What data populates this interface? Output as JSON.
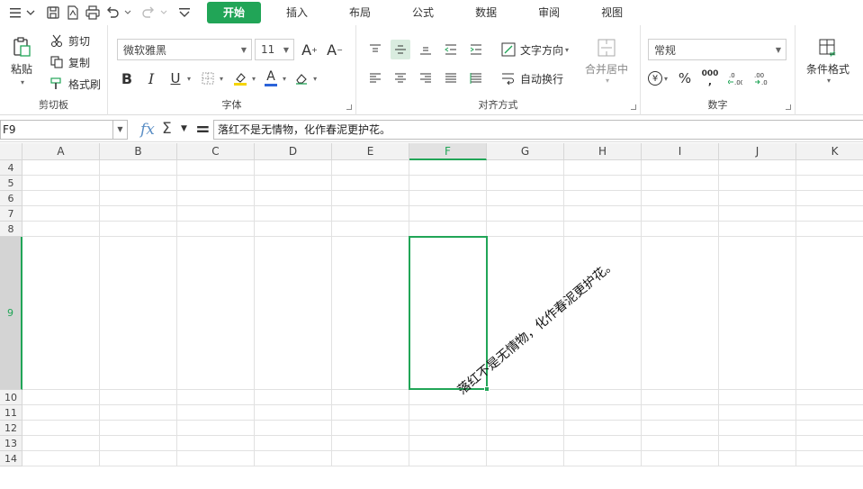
{
  "menubar": {
    "tabs": [
      "开始",
      "插入",
      "布局",
      "公式",
      "数据",
      "审阅",
      "视图"
    ],
    "active_tab": "开始",
    "accent": "#21a557"
  },
  "ribbon": {
    "clipboard": {
      "paste": "粘贴",
      "cut": "剪切",
      "copy": "复制",
      "format_painter": "格式刷",
      "label": "剪切板"
    },
    "font": {
      "family": "微软雅黑",
      "size": "11",
      "label": "字体",
      "bold": "B",
      "italic": "I",
      "underline": "U",
      "font_color": "A"
    },
    "alignment": {
      "text_direction": "文字方向",
      "wrap_text": "自动换行",
      "merge_center": "合并居中",
      "label": "对齐方式"
    },
    "number": {
      "format": "常规",
      "currency": "¥",
      "percent": "%",
      "thousands": "000",
      "label": "数字"
    },
    "styles": {
      "conditional_format": "条件格式"
    }
  },
  "formula_bar": {
    "cell_ref": "F9",
    "content": "落红不是无情物，化作春泥更护花。"
  },
  "sheet": {
    "columns": [
      "A",
      "B",
      "C",
      "D",
      "E",
      "F",
      "G",
      "H",
      "I",
      "J",
      "K"
    ],
    "rows": [
      "4",
      "5",
      "6",
      "7",
      "8",
      "9",
      "10",
      "11",
      "12",
      "13",
      "14"
    ],
    "selected_column": "F",
    "selected_row": "9",
    "cell_text": "落红不是无情物，化作春泥更护花。"
  }
}
